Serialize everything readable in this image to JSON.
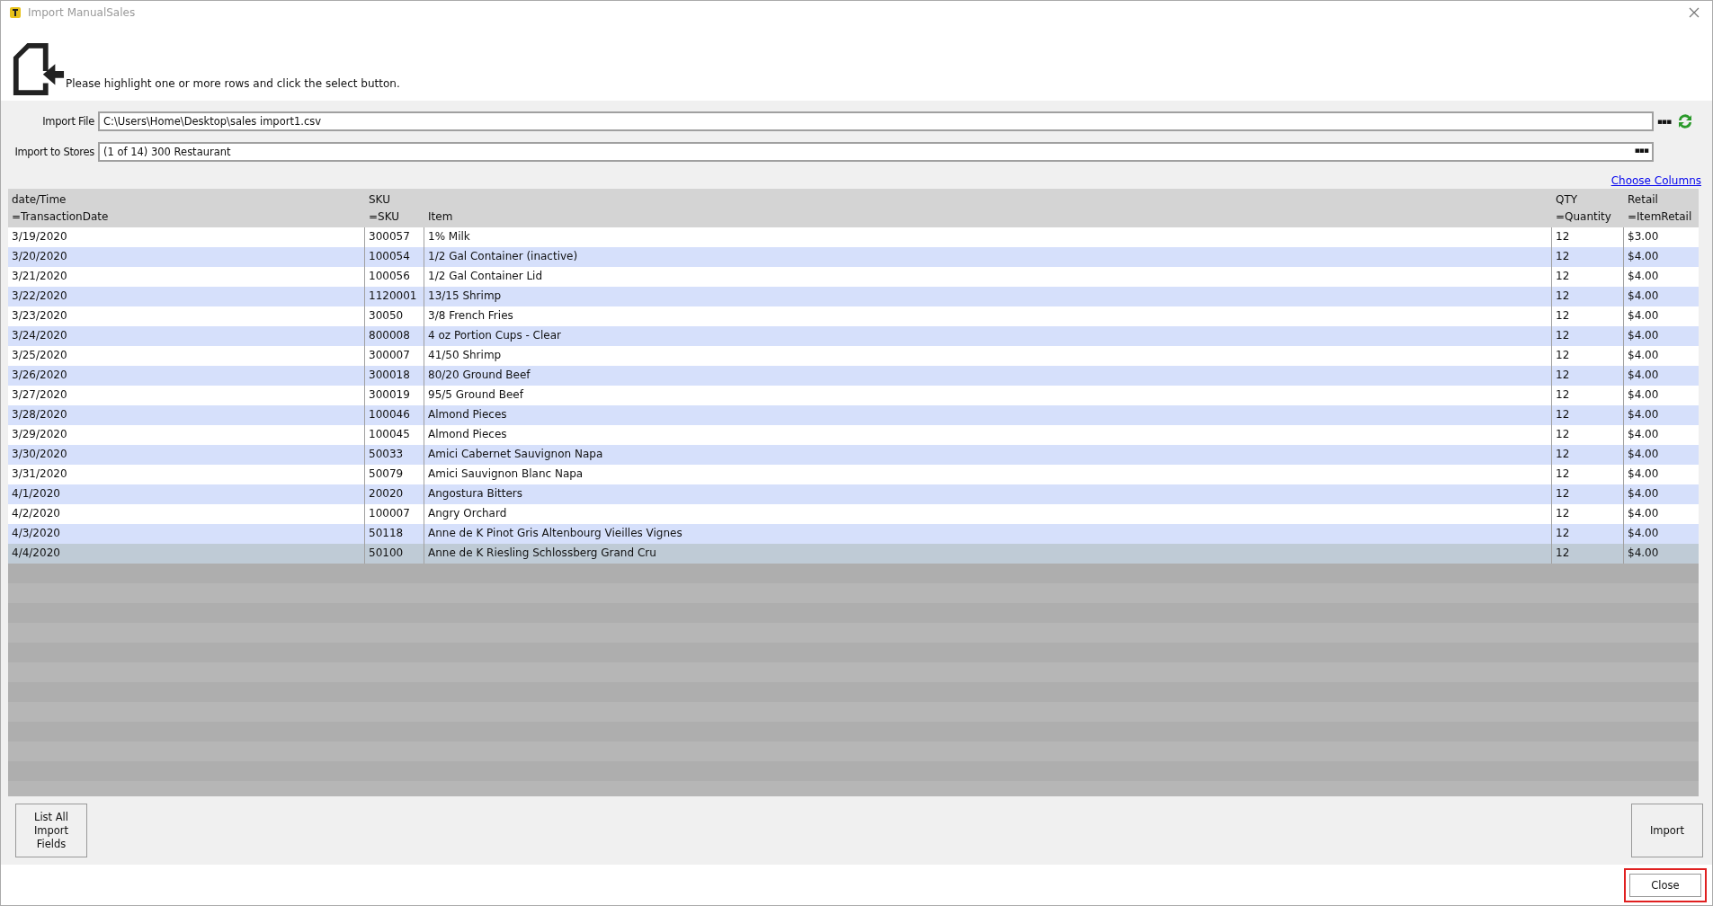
{
  "window": {
    "title": "Import ManualSales"
  },
  "instruction": "Please highlight one or more rows and click the select button.",
  "import_file": {
    "label": "Import File",
    "value": "C:\\Users\\Home\\Desktop\\sales import1.csv",
    "browse": "▪▪▪"
  },
  "import_to_stores": {
    "label": "Import to Stores",
    "value": "(1 of 14) 300 Restaurant",
    "browse": "▪▪▪"
  },
  "choose_columns": "Choose Columns",
  "table": {
    "columns": [
      {
        "name": "date/Time",
        "mapping": "=TransactionDate"
      },
      {
        "name": "SKU",
        "mapping": "=SKU"
      },
      {
        "mapping": "Item"
      },
      {
        "name": "QTY",
        "mapping": "=Quantity"
      },
      {
        "name": "Retail",
        "mapping": "=ItemRetail"
      }
    ],
    "rows": [
      {
        "cells": [
          "3/19/2020",
          "300057",
          "1% Milk",
          "12",
          "$3.00"
        ],
        "selected": false
      },
      {
        "cells": [
          "3/20/2020",
          "100054",
          "1/2 Gal Container (inactive)",
          "12",
          "$4.00"
        ],
        "selected": false
      },
      {
        "cells": [
          "3/21/2020",
          "100056",
          "1/2 Gal Container Lid",
          "12",
          "$4.00"
        ],
        "selected": false
      },
      {
        "cells": [
          "3/22/2020",
          "1120001",
          "13/15 Shrimp",
          "12",
          "$4.00"
        ],
        "selected": false
      },
      {
        "cells": [
          "3/23/2020",
          "30050",
          "3/8 French Fries",
          "12",
          "$4.00"
        ],
        "selected": false
      },
      {
        "cells": [
          "3/24/2020",
          "800008",
          "4 oz Portion Cups - Clear",
          "12",
          "$4.00"
        ],
        "selected": false
      },
      {
        "cells": [
          "3/25/2020",
          "300007",
          "41/50 Shrimp",
          "12",
          "$4.00"
        ],
        "selected": false
      },
      {
        "cells": [
          "3/26/2020",
          "300018",
          "80/20 Ground Beef",
          "12",
          "$4.00"
        ],
        "selected": false
      },
      {
        "cells": [
          "3/27/2020",
          "300019",
          "95/5 Ground Beef",
          "12",
          "$4.00"
        ],
        "selected": false
      },
      {
        "cells": [
          "3/28/2020",
          "100046",
          "Almond Pieces",
          "12",
          "$4.00"
        ],
        "selected": false
      },
      {
        "cells": [
          "3/29/2020",
          "100045",
          "Almond Pieces",
          "12",
          "$4.00"
        ],
        "selected": false
      },
      {
        "cells": [
          "3/30/2020",
          "50033",
          "Amici Cabernet Sauvignon Napa",
          "12",
          "$4.00"
        ],
        "selected": false
      },
      {
        "cells": [
          "3/31/2020",
          "50079",
          "Amici Sauvignon Blanc Napa",
          "12",
          "$4.00"
        ],
        "selected": false
      },
      {
        "cells": [
          "4/1/2020",
          "20020",
          "Angostura Bitters",
          "12",
          "$4.00"
        ],
        "selected": false
      },
      {
        "cells": [
          "4/2/2020",
          "100007",
          "Angry Orchard",
          "12",
          "$4.00"
        ],
        "selected": false
      },
      {
        "cells": [
          "4/3/2020",
          "50118",
          "Anne de K Pinot Gris Altenbourg Vieilles Vignes",
          "12",
          "$4.00"
        ],
        "selected": false
      },
      {
        "cells": [
          "4/4/2020",
          "50100",
          "Anne de K Riesling Schlossberg Grand Cru",
          "12",
          "$4.00"
        ],
        "selected": true
      }
    ]
  },
  "buttons": {
    "list_fields": "List All Import Fields",
    "import": "Import",
    "close": "Close"
  },
  "close_highlighted": true
}
